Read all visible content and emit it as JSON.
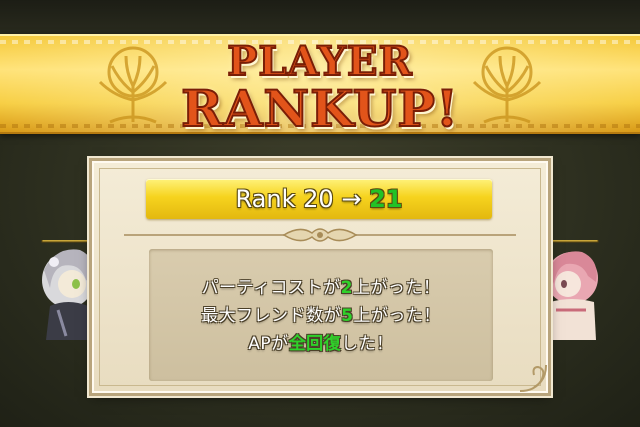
{
  "banner": {
    "title_line1": "PLAYER",
    "title_line2": "RANKUP!"
  },
  "rank": {
    "label": "Rank",
    "old": "20",
    "arrow": "→",
    "new": "21"
  },
  "messages": [
    {
      "pre": "パーティコストが",
      "value": "2",
      "post": "上がった！"
    },
    {
      "pre": "最大フレンド数が",
      "value": "5",
      "post": "上がった！"
    },
    {
      "pre": "APが",
      "value": "全回復",
      "post": "した！"
    }
  ],
  "colors": {
    "banner_gold": "#f5c93a",
    "title_orange": "#e2541a",
    "rank_bar_yellow": "#f6d31e",
    "highlight_green": "#2fd12a",
    "panel_cream": "#f4ecd7"
  },
  "icons": {
    "banner_emblem": "golden-tree-icon",
    "divider": "ornament-divider-icon"
  }
}
